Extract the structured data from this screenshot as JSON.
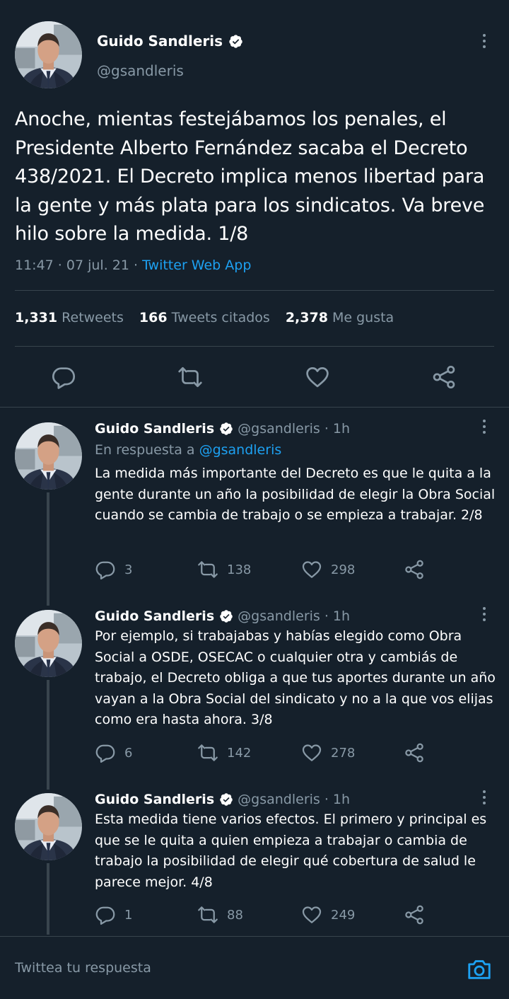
{
  "main_tweet": {
    "author_name": "Guido Sandleris",
    "author_handle": "@gsandleris",
    "text": "Anoche, mientas festejábamos los penales, el Presidente Alberto Fernández sacaba el Decreto 438/2021. El Decreto implica menos libertad para la gente y más plata para los sindicatos. Va breve hilo sobre la medida. 1/8",
    "time": "11:47 · 07 jul. 21 · ",
    "app": "Twitter Web App",
    "retweets_count": "1,331",
    "retweets_label": "Retweets",
    "quotes_count": "166",
    "quotes_label": "Tweets citados",
    "likes_count": "2,378",
    "likes_label": "Me gusta"
  },
  "replies": [
    {
      "name": "Guido Sandleris",
      "handle": "@gsandleris · 1h",
      "in_reply_prefix": "En respuesta a ",
      "in_reply_to": "@gsandleris",
      "text": "La medida más importante del Decreto es que le quita a la gente durante un año la posibilidad de elegir la Obra Social cuando se cambia de trabajo o se empieza a trabajar. 2/8",
      "replies": "3",
      "retweets": "138",
      "likes": "298"
    },
    {
      "name": "Guido Sandleris",
      "handle": "@gsandleris · 1h",
      "text": "Por ejemplo, si trabajabas y habías elegido como Obra Social a OSDE, OSECAC o cualquier otra y cambiás de trabajo, el Decreto obliga a que tus aportes durante un año vayan a la Obra Social del sindicato y no a la que vos elijas como era hasta ahora. 3/8",
      "replies": "6",
      "retweets": "142",
      "likes": "278"
    },
    {
      "name": "Guido Sandleris",
      "handle": "@gsandleris · 1h",
      "text": "Esta medida tiene varios efectos. El primero y principal es que se le quita a quien empieza a trabajar o cambia de trabajo la posibilidad de elegir qué cobertura de salud le parece mejor. 4/8",
      "replies": "1",
      "retweets": "88",
      "likes": "249"
    }
  ],
  "compose": {
    "placeholder": "Twittea tu respuesta"
  },
  "colors": {
    "background": "#15202b",
    "accent": "#1da1f2",
    "muted": "#8899a6",
    "divider": "#38444d"
  },
  "icons": [
    "verified-badge-icon",
    "more-icon",
    "reply-icon",
    "retweet-icon",
    "like-icon",
    "share-icon",
    "camera-icon"
  ]
}
